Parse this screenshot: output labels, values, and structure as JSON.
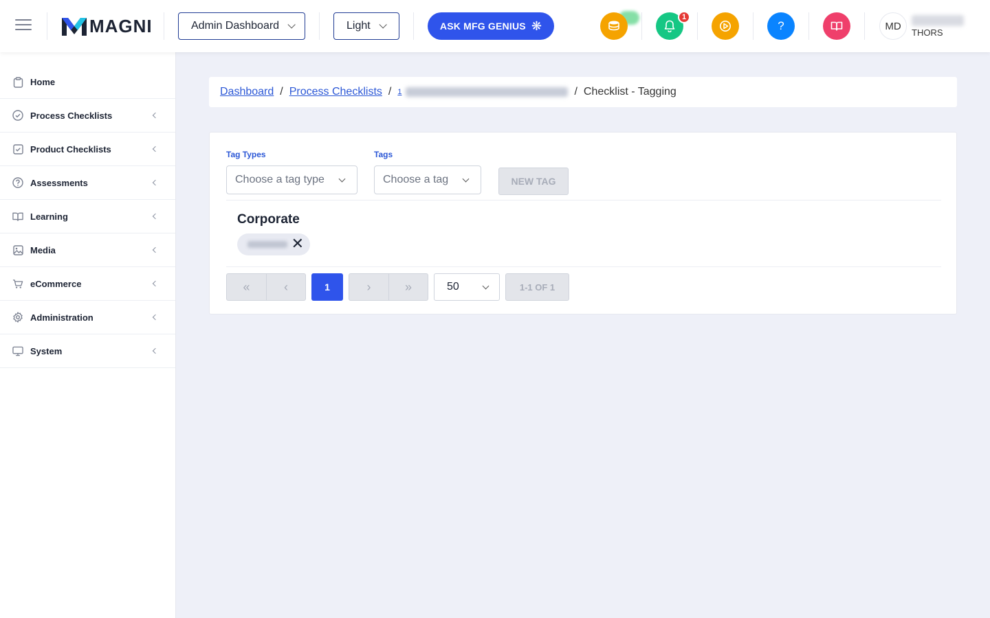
{
  "header": {
    "logo_text": "MAGNI",
    "dashboard_select": "Admin Dashboard",
    "theme_select": "Light",
    "ask_button": "ASK MFG GENIUS",
    "notification_count": "1",
    "help_glyph": "?",
    "avatar_initials": "MD",
    "user_org": "THORS",
    "colors": {
      "coins": "#f5a300",
      "notifications": "#16c784",
      "play": "#f5a300",
      "help": "#0a84ff",
      "library": "#ef3f6b",
      "accent": "#2f54eb"
    }
  },
  "sidebar": {
    "items": [
      {
        "label": "Home",
        "icon": "clipboard-icon"
      },
      {
        "label": "Process Checklists",
        "icon": "check-circle-icon"
      },
      {
        "label": "Product Checklists",
        "icon": "check-square-icon"
      },
      {
        "label": "Assessments",
        "icon": "question-circle-icon"
      },
      {
        "label": "Learning",
        "icon": "book-icon"
      },
      {
        "label": "Media",
        "icon": "image-icon"
      },
      {
        "label": "eCommerce",
        "icon": "cart-icon"
      },
      {
        "label": "Administration",
        "icon": "gear-icon"
      },
      {
        "label": "System",
        "icon": "monitor-icon"
      }
    ]
  },
  "breadcrumb": {
    "dashboard": "Dashboard",
    "process_checklists": "Process Checklists",
    "checklist_prefix": "1",
    "current": "Checklist - Tagging",
    "separator": "/"
  },
  "tagging": {
    "tag_types_label": "Tag Types",
    "tag_types_placeholder": "Choose a tag type",
    "tags_label": "Tags",
    "tags_placeholder": "Choose a tag",
    "new_tag_button": "NEW TAG",
    "group_title": "Corporate"
  },
  "pagination": {
    "current_page": "1",
    "page_size": "50",
    "range": "1-1 OF 1"
  }
}
